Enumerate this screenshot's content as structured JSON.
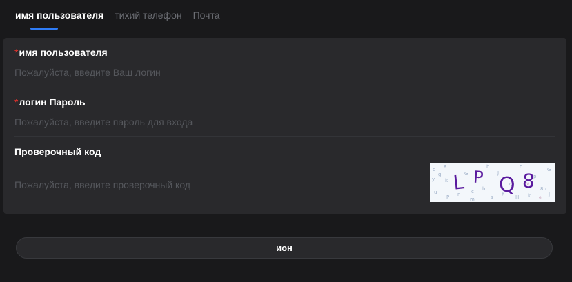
{
  "tabs": [
    {
      "label": "имя пользователя",
      "active": true
    },
    {
      "label": "тихий телефон",
      "active": false
    },
    {
      "label": "Почта",
      "active": false
    }
  ],
  "form": {
    "username": {
      "required_mark": "*",
      "label": "имя пользователя",
      "placeholder": "Пожалуйста, введите Ваш логин",
      "value": ""
    },
    "password": {
      "required_mark": "*",
      "label": "логин Пароль",
      "placeholder": "Пожалуйста, введите пароль для входа",
      "value": ""
    },
    "captcha": {
      "label": "Проверочный код",
      "placeholder": "Пожалуйста, введите проверочный код",
      "value": "",
      "image_text": "LPQ8"
    }
  },
  "submit": {
    "label": "ион"
  },
  "colors": {
    "accent": "#2f7cf6",
    "required": "#e5322d",
    "captcha_glyphs": "#5a1a9e"
  }
}
